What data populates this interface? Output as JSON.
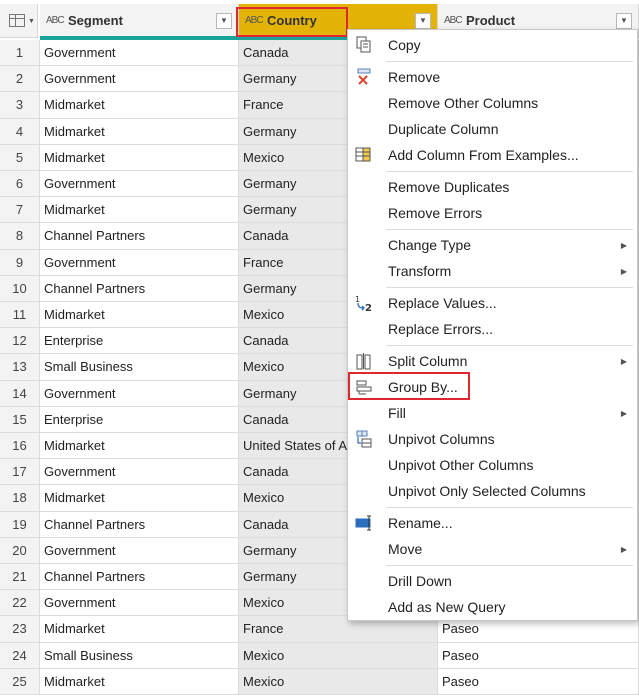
{
  "columns": {
    "segment": "Segment",
    "country": "Country",
    "product": "Product",
    "type_glyph": "ABC"
  },
  "rows": [
    {
      "i": "1",
      "segment": "Government",
      "country": "Canada",
      "product": ""
    },
    {
      "i": "2",
      "segment": "Government",
      "country": "Germany",
      "product": ""
    },
    {
      "i": "3",
      "segment": "Midmarket",
      "country": "France",
      "product": ""
    },
    {
      "i": "4",
      "segment": "Midmarket",
      "country": "Germany",
      "product": ""
    },
    {
      "i": "5",
      "segment": "Midmarket",
      "country": "Mexico",
      "product": ""
    },
    {
      "i": "6",
      "segment": "Government",
      "country": "Germany",
      "product": ""
    },
    {
      "i": "7",
      "segment": "Midmarket",
      "country": "Germany",
      "product": ""
    },
    {
      "i": "8",
      "segment": "Channel Partners",
      "country": "Canada",
      "product": ""
    },
    {
      "i": "9",
      "segment": "Government",
      "country": "France",
      "product": ""
    },
    {
      "i": "10",
      "segment": "Channel Partners",
      "country": "Germany",
      "product": ""
    },
    {
      "i": "11",
      "segment": "Midmarket",
      "country": "Mexico",
      "product": ""
    },
    {
      "i": "12",
      "segment": "Enterprise",
      "country": "Canada",
      "product": ""
    },
    {
      "i": "13",
      "segment": "Small Business",
      "country": "Mexico",
      "product": ""
    },
    {
      "i": "14",
      "segment": "Government",
      "country": "Germany",
      "product": ""
    },
    {
      "i": "15",
      "segment": "Enterprise",
      "country": "Canada",
      "product": ""
    },
    {
      "i": "16",
      "segment": "Midmarket",
      "country": "United States of A",
      "product": ""
    },
    {
      "i": "17",
      "segment": "Government",
      "country": "Canada",
      "product": ""
    },
    {
      "i": "18",
      "segment": "Midmarket",
      "country": "Mexico",
      "product": ""
    },
    {
      "i": "19",
      "segment": "Channel Partners",
      "country": "Canada",
      "product": ""
    },
    {
      "i": "20",
      "segment": "Government",
      "country": "Germany",
      "product": ""
    },
    {
      "i": "21",
      "segment": "Channel Partners",
      "country": "Germany",
      "product": ""
    },
    {
      "i": "22",
      "segment": "Government",
      "country": "Mexico",
      "product": ""
    },
    {
      "i": "23",
      "segment": "Midmarket",
      "country": "France",
      "product": "Paseo"
    },
    {
      "i": "24",
      "segment": "Small Business",
      "country": "Mexico",
      "product": "Paseo"
    },
    {
      "i": "25",
      "segment": "Midmarket",
      "country": "Mexico",
      "product": "Paseo"
    }
  ],
  "menu": {
    "copy": "Copy",
    "remove": "Remove",
    "remove_other": "Remove Other Columns",
    "duplicate": "Duplicate Column",
    "add_from_examples": "Add Column From Examples...",
    "remove_duplicates": "Remove Duplicates",
    "remove_errors": "Remove Errors",
    "change_type": "Change Type",
    "transform": "Transform",
    "replace_values": "Replace Values...",
    "replace_errors": "Replace Errors...",
    "split_column": "Split Column",
    "group_by": "Group By...",
    "fill": "Fill",
    "unpivot": "Unpivot Columns",
    "unpivot_other": "Unpivot Other Columns",
    "unpivot_selected": "Unpivot Only Selected Columns",
    "rename": "Rename...",
    "move": "Move",
    "drill_down": "Drill Down",
    "add_as_query": "Add as New Query"
  },
  "colors": {
    "selected_header": "#e3b406",
    "highlight_border": "#e0262e",
    "column_quality_bar": "#1aa39b"
  }
}
